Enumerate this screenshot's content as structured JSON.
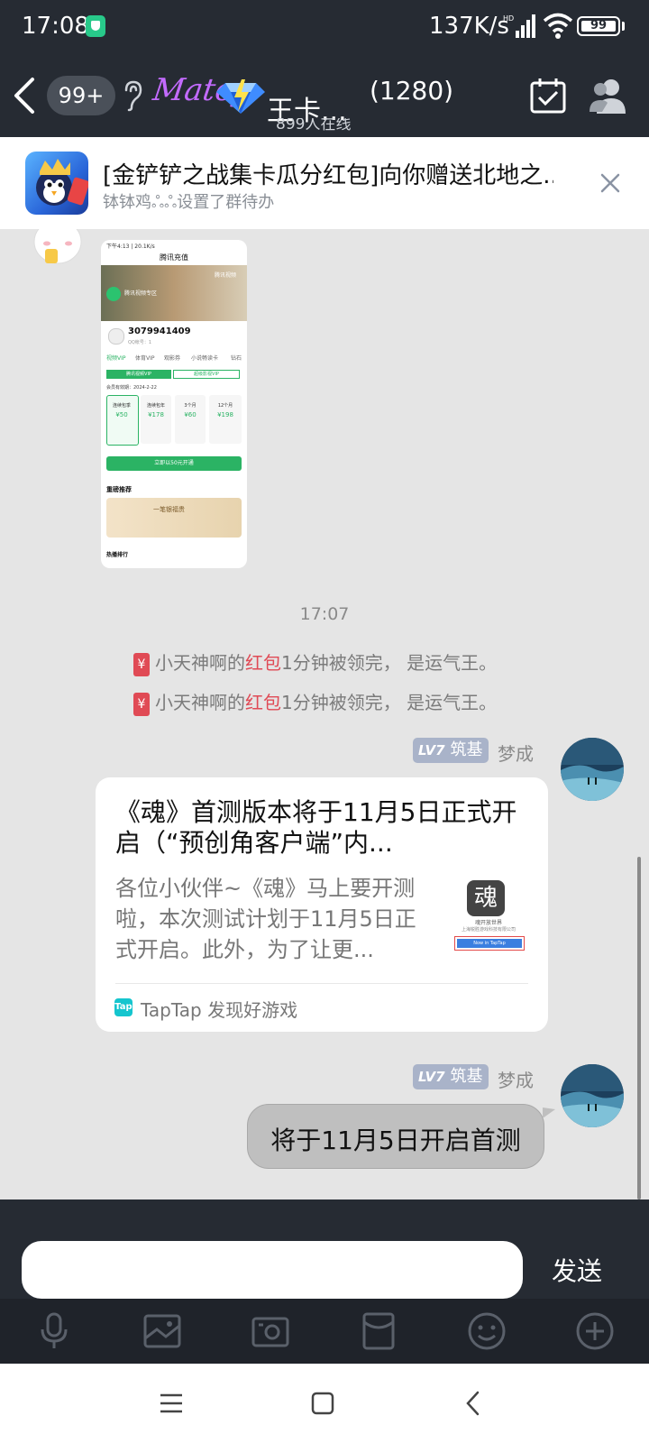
{
  "status_bar": {
    "time": "17:08",
    "net_speed": "137K/s",
    "battery": "99"
  },
  "header": {
    "unread_badge": "99+",
    "logo_text": "Matey",
    "group_name": "王卡...",
    "member_count": "(1280)",
    "online_tag": "899人在线"
  },
  "notice": {
    "title": "[金铲铲之战集卡瓜分红包]向你赠送北地之...",
    "subtitle": "钵钵鸡ஃஃ设置了群待办"
  },
  "screenshot_preview": {
    "status": "下午4:13 | 20.1K/s",
    "page_title": "腾讯充值",
    "banner_brand": "腾讯视频专区",
    "banner_tag": "腾讯视频",
    "account_id": "3079941409",
    "account_sub": "QQ帐号：1",
    "tabs": [
      "视频VIP",
      "体育VIP",
      "观影券",
      "小说畅读卡",
      "钻石"
    ],
    "vip_tab_a": "腾讯视频VIP",
    "vip_tab_b": "超级影视VIP",
    "expiry": "会员有效期：2024-2-22",
    "plans": [
      {
        "name": "连续包季",
        "price": "¥50"
      },
      {
        "name": "连续包年",
        "price": "¥178"
      },
      {
        "name": "3个月",
        "price": "¥60"
      },
      {
        "name": "12个月",
        "price": "¥198"
      }
    ],
    "cta": "立即以50元开通",
    "section": "重磅推荐",
    "promo": "一笔银福贵",
    "footer": "热播排行"
  },
  "chat": {
    "time_separator": "17:07",
    "system_messages": [
      {
        "prefix": "小天神啊的",
        "highlight": "红包",
        "suffix": "1分钟被领完，  是运气王。"
      },
      {
        "prefix": "小天神啊的",
        "highlight": "红包",
        "suffix": "1分钟被领完，  是运气王。"
      }
    ],
    "messages": [
      {
        "level": "LV7",
        "rank": "筑基",
        "sender": "梦成",
        "card": {
          "title": "《魂》首测版本将于11月5日正式开启（“预创角客户端”内...",
          "description": "各位小伙伴~《魂》马上要开测啦，本次测试计划于11月5日正式开启。此外，为了让更...",
          "thumb_caption": "魂开放世界",
          "thumb_company": "上海锐胜游戏科技有限公司",
          "thumb_button": "Now in TapTap",
          "source_icon": "Tap",
          "source": "TapTap 发现好游戏"
        }
      },
      {
        "level": "LV7",
        "rank": "筑基",
        "sender": "梦成",
        "text": "将于11月5日开启首测"
      }
    ]
  },
  "input": {
    "value": "",
    "send_label": "发送"
  },
  "toolbar_icons": [
    "mic-icon",
    "image-icon",
    "camera-icon",
    "red-packet-icon",
    "emoji-icon",
    "plus-icon"
  ],
  "colors": {
    "bar_bg": "#262b33",
    "chat_bg": "#e5e5e5",
    "highlight": "#e04a55",
    "level_tag": "#a9b3c9",
    "bubble": "#bfbfbf"
  }
}
